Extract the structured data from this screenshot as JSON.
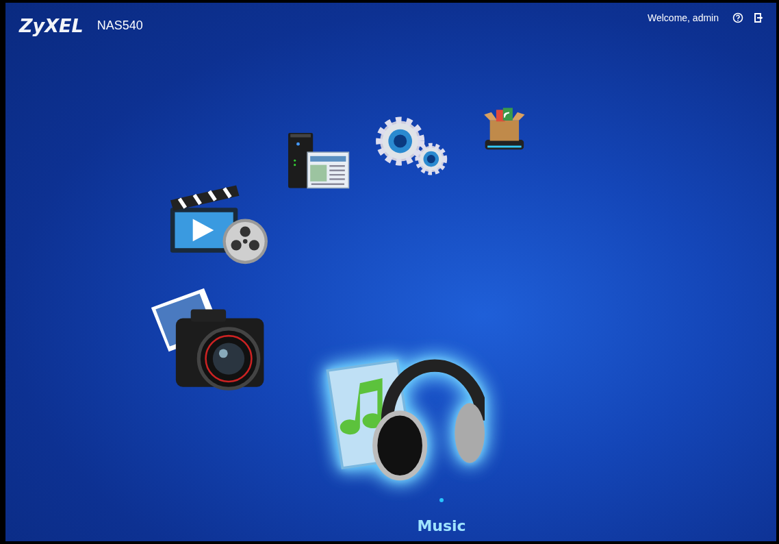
{
  "header": {
    "logo": "ZyXEL",
    "model": "NAS540",
    "welcome": "Welcome, admin"
  },
  "apps": [
    {
      "kind": "video",
      "selected": false
    },
    {
      "kind": "server",
      "selected": false
    },
    {
      "kind": "settings",
      "selected": false
    },
    {
      "kind": "package",
      "selected": false
    },
    {
      "kind": "photo",
      "selected": false
    },
    {
      "kind": "music",
      "selected": true
    }
  ],
  "caption": "Music"
}
